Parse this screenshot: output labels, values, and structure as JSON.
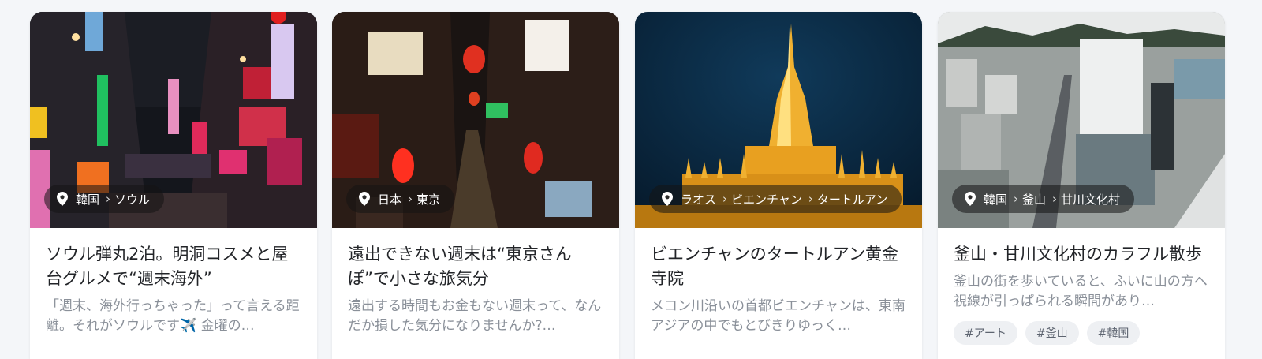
{
  "cards": [
    {
      "location": [
        "韓国",
        "ソウル"
      ],
      "title": "ソウル弾丸2泊。明洞コスメと屋台グルメで“週末海外”",
      "desc": "「週末、海外行っちゃった」って言える距離。それがソウルです✈️ 金曜の…",
      "tags": []
    },
    {
      "location": [
        "日本",
        "東京"
      ],
      "title": "遠出できない週末は“東京さんぽ”で小さな旅気分",
      "desc": "遠出する時間もお金もない週末って、なんだか損した気分になりませんか?…",
      "tags": []
    },
    {
      "location": [
        "ラオス",
        "ビエンチャン",
        "タートルアン"
      ],
      "title": "ビエンチャンのタートルアン黄金寺院",
      "desc": "メコン川沿いの首都ビエンチャンは、東南アジアの中でもとびきりゆっく…",
      "tags": []
    },
    {
      "location": [
        "韓国",
        "釜山",
        "甘川文化村"
      ],
      "title": "釜山・甘川文化村のカラフル散歩",
      "desc": "釜山の街を歩いていると、ふいに山の方へ視線が引っぱられる瞬間があり…",
      "tags": [
        "#アート",
        "#釜山",
        "#韓国"
      ]
    }
  ]
}
